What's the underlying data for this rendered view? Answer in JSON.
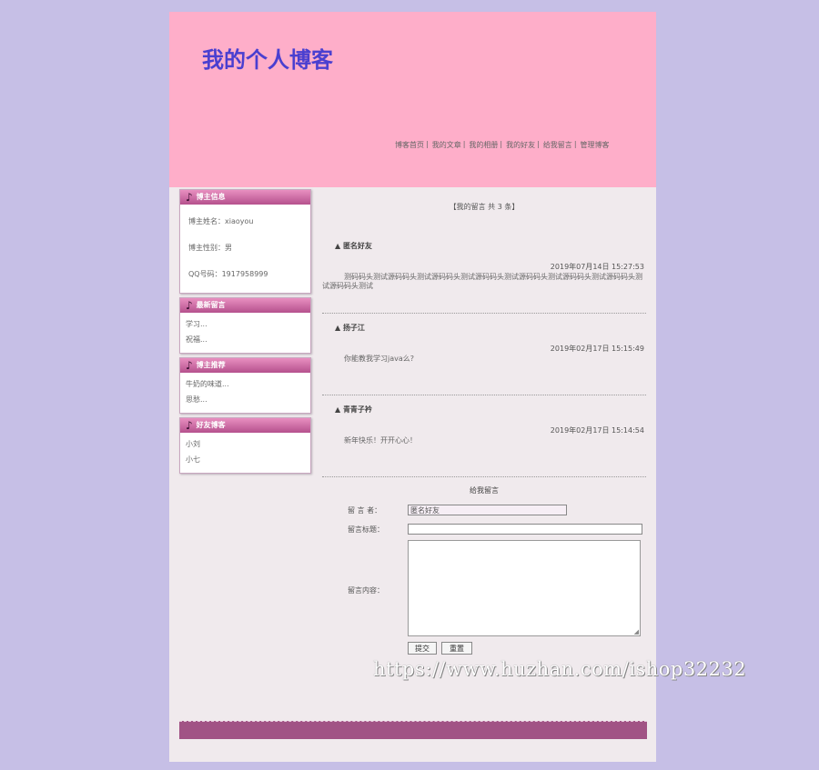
{
  "header": {
    "site_title": "我的个人博客",
    "nav": [
      "博客首页",
      "我的文章",
      "我的相册",
      "我的好友",
      "给我留言",
      "管理博客"
    ],
    "nav_separator": "|"
  },
  "sidebar": {
    "blogger_info": {
      "title": "博主信息",
      "rows": [
        "博主姓名：xiaoyou",
        "博主性别：男",
        "QQ号码：1917958999"
      ]
    },
    "latest_messages": {
      "title": "最新留言",
      "items": [
        "学习...",
        "祝福..."
      ]
    },
    "recommended": {
      "title": "博主推荐",
      "items": [
        "牛奶的味道...",
        "思愁..."
      ]
    },
    "friend_blogs": {
      "title": "好友博客",
      "items": [
        "小刘",
        "小七"
      ]
    }
  },
  "main": {
    "message_count": "【我的留言 共 3 条】",
    "messages": [
      {
        "name": "▲ 匿名好友",
        "date": "2019年07月14日 15:27:53",
        "text": "测码码头测试源码码头测试源码码头测试源码码头测试源码码头测试源码码头测试源码码头测试源码码头测试"
      },
      {
        "name": "▲ 扬子江",
        "date": "2019年02月17日 15:15:49",
        "text": "你能教我学习java么?"
      },
      {
        "name": "▲ 青青子衿",
        "date": "2019年02月17日 15:14:54",
        "text": "新年快乐！开开心心！"
      }
    ]
  },
  "form": {
    "title": "给我留言",
    "author_label": "留 言 者：",
    "author_value": "匿名好友",
    "subject_label": "留言标题：",
    "content_label": "留言内容：",
    "submit_label": "提交",
    "reset_label": "重置"
  },
  "watermark": "https://www.huzhan.com/ishop32232",
  "colors": {
    "page_bg": "#c6bfe6",
    "header_bg": "#feaec9",
    "title": "#4a3fd0",
    "box_head": "#b5518d",
    "footer": "#a15385"
  }
}
